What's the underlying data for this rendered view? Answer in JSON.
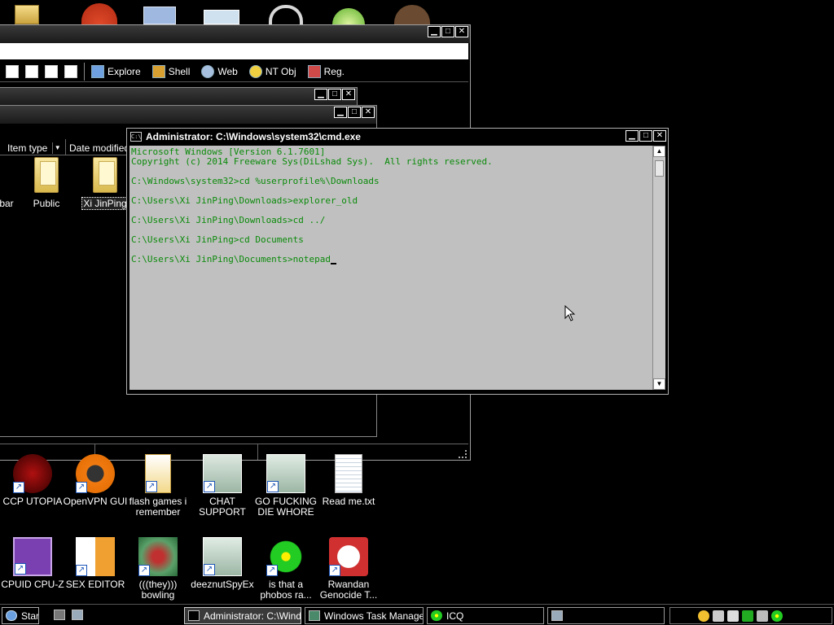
{
  "desktop": {
    "top_row": [
      {
        "name": "folder-icon"
      },
      {
        "name": "browser-icon"
      },
      {
        "name": "photo-icon"
      },
      {
        "name": "window-icon"
      },
      {
        "name": "chain-icon"
      },
      {
        "name": "lime-icon"
      },
      {
        "name": "portrait-icon"
      }
    ],
    "row1": [
      {
        "label": "CCP UTOPIA",
        "icon": "ccp-utopia-icon"
      },
      {
        "label": "OpenVPN GUI",
        "icon": "openvpn-icon"
      },
      {
        "label": "flash games i remember",
        "icon": "flash-games-icon"
      },
      {
        "label": "CHAT SUPPORT",
        "icon": "chat-support-icon"
      },
      {
        "label": "GO FUCKING DIE WHORE",
        "icon": "window-app-icon"
      },
      {
        "label": "Read me.txt",
        "icon": "text-file-icon"
      }
    ],
    "row2": [
      {
        "label": "CPUID CPU-Z",
        "icon": "cpuz-icon"
      },
      {
        "label": "SEX EDITOR",
        "icon": "hxd-icon"
      },
      {
        "label": "(((they))) bowling",
        "icon": "bowling-icon"
      },
      {
        "label": "deeznutSpyEx",
        "icon": "spyex-icon"
      },
      {
        "label": "is that a phobos ra...",
        "icon": "icq-flower-icon"
      },
      {
        "label": "Rwandan Genocide T...",
        "icon": "rwandan-icon"
      }
    ]
  },
  "explorer": {
    "toolbar": [
      {
        "label": "Explore"
      },
      {
        "label": "Shell"
      },
      {
        "label": "Web"
      },
      {
        "label": "NT Obj"
      },
      {
        "label": "Reg."
      }
    ],
    "columns": [
      {
        "label": "Item type"
      },
      {
        "label": "Date modified"
      }
    ],
    "items": [
      {
        "label": "bar"
      },
      {
        "label": "Public"
      },
      {
        "label": "Xi JinPing"
      }
    ]
  },
  "cmd": {
    "title": "Administrator: C:\\Windows\\system32\\cmd.exe",
    "icon_text": "C:\\",
    "lines": [
      "Microsoft Windows [Version 6.1.7601]",
      "Copyright (c) 2014 Freeware Sys(DiLshad Sys).  All rights reserved.",
      "",
      "C:\\Windows\\system32>cd %userprofile%\\Downloads",
      "",
      "C:\\Users\\Xi JinPing\\Downloads>explorer_old",
      "",
      "C:\\Users\\Xi JinPing\\Downloads>cd ../",
      "",
      "C:\\Users\\Xi JinPing>cd Documents",
      "",
      "C:\\Users\\Xi JinPing\\Documents>notepad"
    ],
    "text_color": "#0a8a0a",
    "console_bg": "#c0c0c0"
  },
  "window_buttons": {
    "minimize": "▁",
    "maximize": "□",
    "close": "✕"
  },
  "taskbar": {
    "start_label": "Start",
    "tasks": [
      {
        "label": "Administrator: C:\\Wind...",
        "active": true
      },
      {
        "label": "Windows Task Manager",
        "active": false
      },
      {
        "label": "ICQ",
        "active": false
      },
      {
        "label": "",
        "active": false
      }
    ]
  }
}
